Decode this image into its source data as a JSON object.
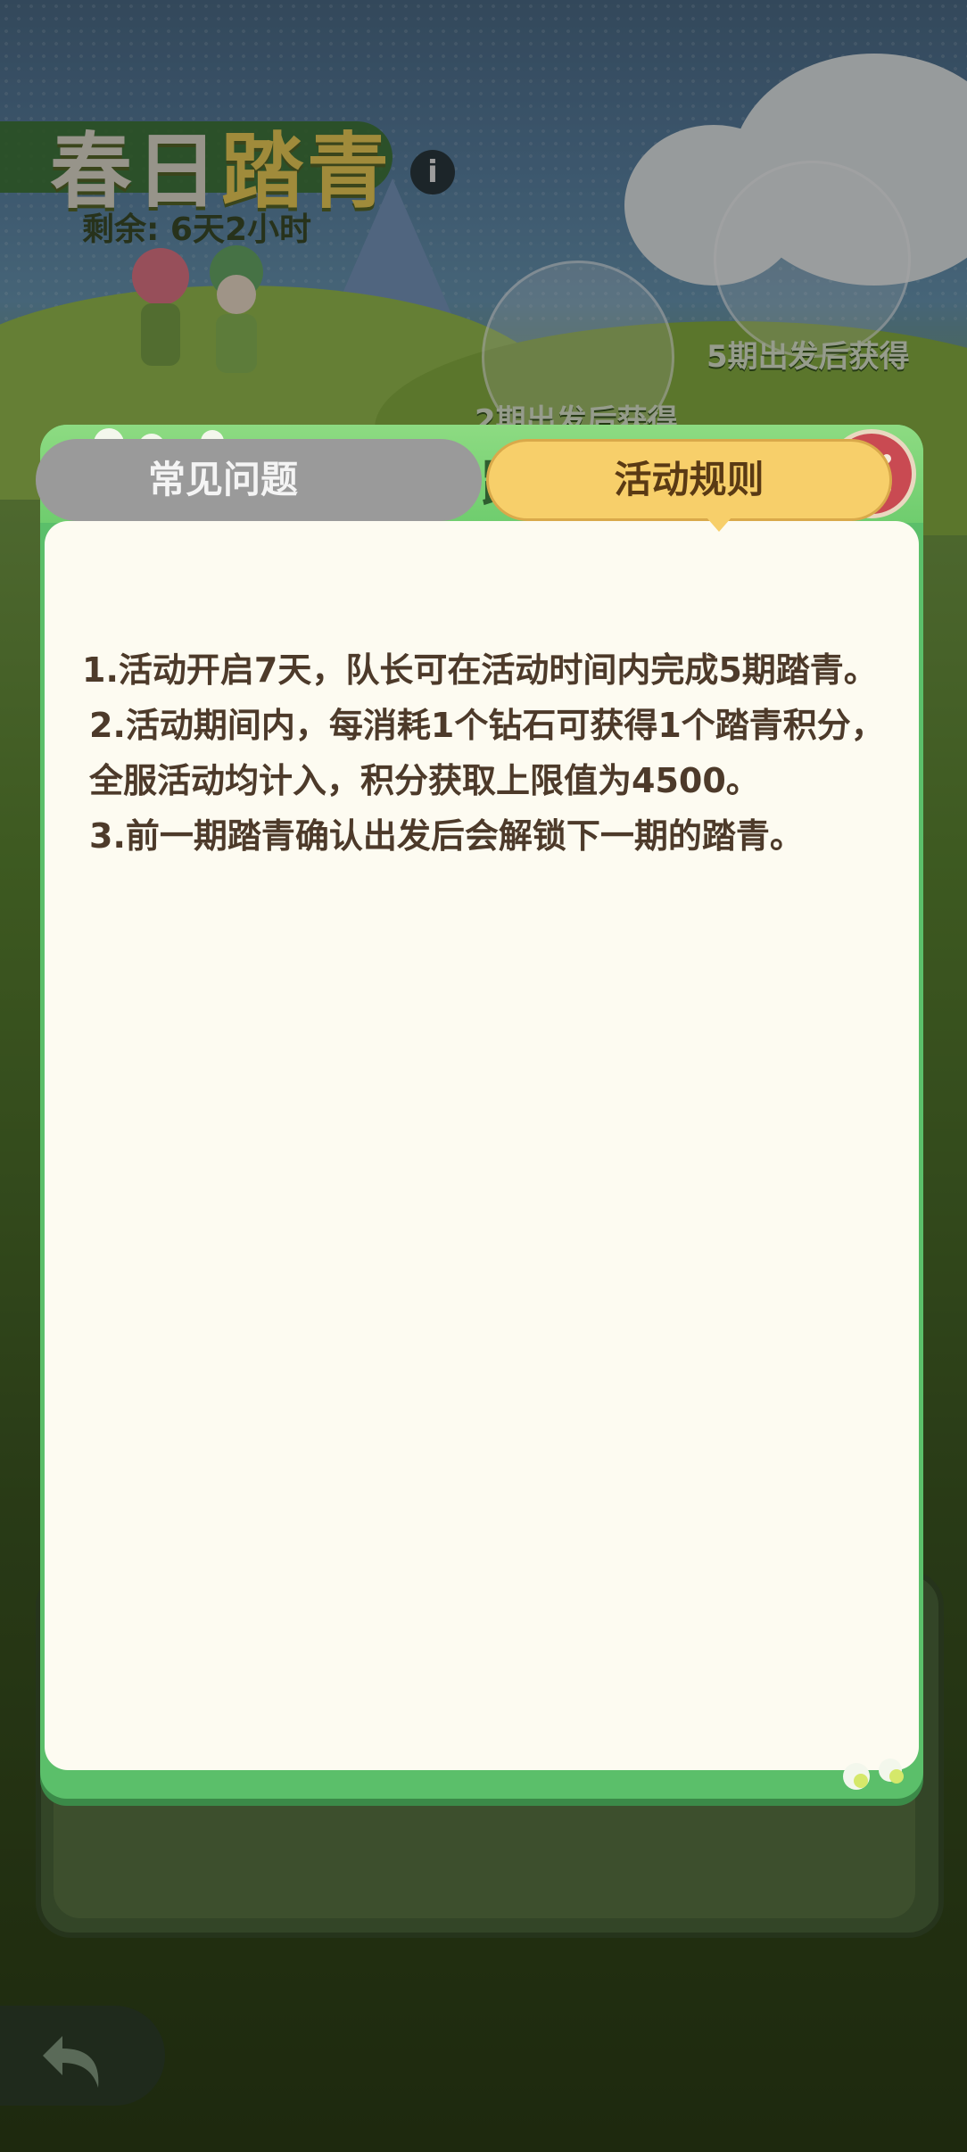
{
  "background": {
    "event_title_part1": "春日",
    "event_title_part2": "踏青",
    "info_icon": "i",
    "remaining_time": "剩余: 6天2小时",
    "reward_2_label": "2期出发后获得",
    "reward_5_label": "5期出发后获得"
  },
  "modal": {
    "title": "春日踏青",
    "tabs": [
      {
        "label": "常见问题",
        "active": false
      },
      {
        "label": "活动规则",
        "active": true
      }
    ],
    "rules": [
      "1.活动开启7天，队长可在活动时间内完成5期踏青。",
      "2.活动期间内，每消耗1个钻石可获得1个踏青积分，全服活动均计入，积分获取上限值为4500。",
      "3.前一期踏青确认出发后会解锁下一期的踏青。"
    ]
  },
  "colors": {
    "modal_green": "#5bbf6a",
    "tab_active": "#f7cf6a",
    "tab_inactive": "#9a9a9a",
    "close_red": "#c94a52",
    "text_brown": "#4d3a2a"
  },
  "icons": {
    "close": "close-icon",
    "back": "back-arrow-icon",
    "info": "info-icon"
  }
}
